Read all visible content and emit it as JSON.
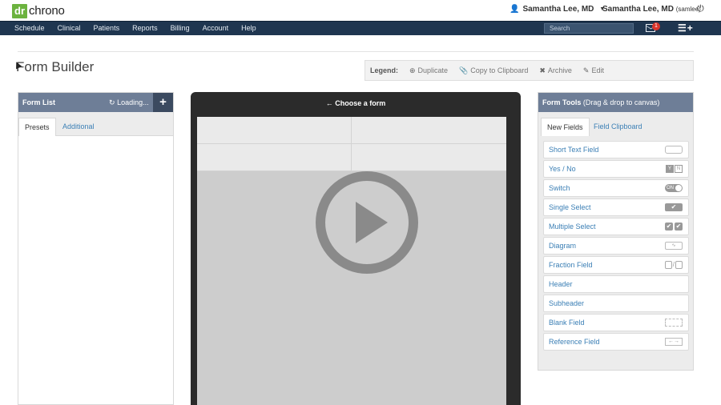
{
  "header": {
    "logo_dr": "dr",
    "logo_rest": "chrono",
    "user_menu": "Samantha Lee, MD",
    "account_name": "Samantha Lee, MD",
    "account_username": "(samlee)"
  },
  "nav": {
    "items": [
      "Schedule",
      "Clinical",
      "Patients",
      "Reports",
      "Billing",
      "Account",
      "Help"
    ],
    "search_placeholder": "Search",
    "message_count": "1"
  },
  "page": {
    "title": "Form Builder"
  },
  "legend": {
    "label": "Legend:",
    "items": [
      {
        "label": "Duplicate",
        "icon": "plus-circle-icon"
      },
      {
        "label": "Copy to Clipboard",
        "icon": "paperclip-icon"
      },
      {
        "label": "Archive",
        "icon": "x-icon"
      },
      {
        "label": "Edit",
        "icon": "pencil-icon"
      }
    ]
  },
  "form_list": {
    "title": "Form List",
    "loading": "Loading...",
    "tabs": [
      "Presets",
      "Additional"
    ]
  },
  "canvas": {
    "header": "Choose a form"
  },
  "form_tools": {
    "title": "Form Tools",
    "subtitle": "(Drag & drop to canvas)",
    "tabs": [
      "New Fields",
      "Field Clipboard"
    ],
    "fields": [
      {
        "label": "Short Text Field",
        "icon": "text-box-icon"
      },
      {
        "label": "Yes / No",
        "icon": "yes-no-icon",
        "icon_text": [
          "Y",
          "N"
        ]
      },
      {
        "label": "Switch",
        "icon": "switch-icon",
        "icon_text": "ON"
      },
      {
        "label": "Single Select",
        "icon": "checkmark-icon"
      },
      {
        "label": "Multiple Select",
        "icon": "double-checkmark-icon"
      },
      {
        "label": "Diagram",
        "icon": "diagram-icon"
      },
      {
        "label": "Fraction Field",
        "icon": "fraction-icon"
      },
      {
        "label": "Header",
        "icon": ""
      },
      {
        "label": "Subheader",
        "icon": ""
      },
      {
        "label": "Blank Field",
        "icon": "dashed-box-icon"
      },
      {
        "label": "Reference Field",
        "icon": "reference-arrows-icon"
      }
    ]
  },
  "colors": {
    "nav_bg": "#1f3650",
    "panel_head": "#6e7e97",
    "logo_green": "#6cb33f",
    "link_blue": "#3b7fb5",
    "badge_red": "#d9342b"
  }
}
